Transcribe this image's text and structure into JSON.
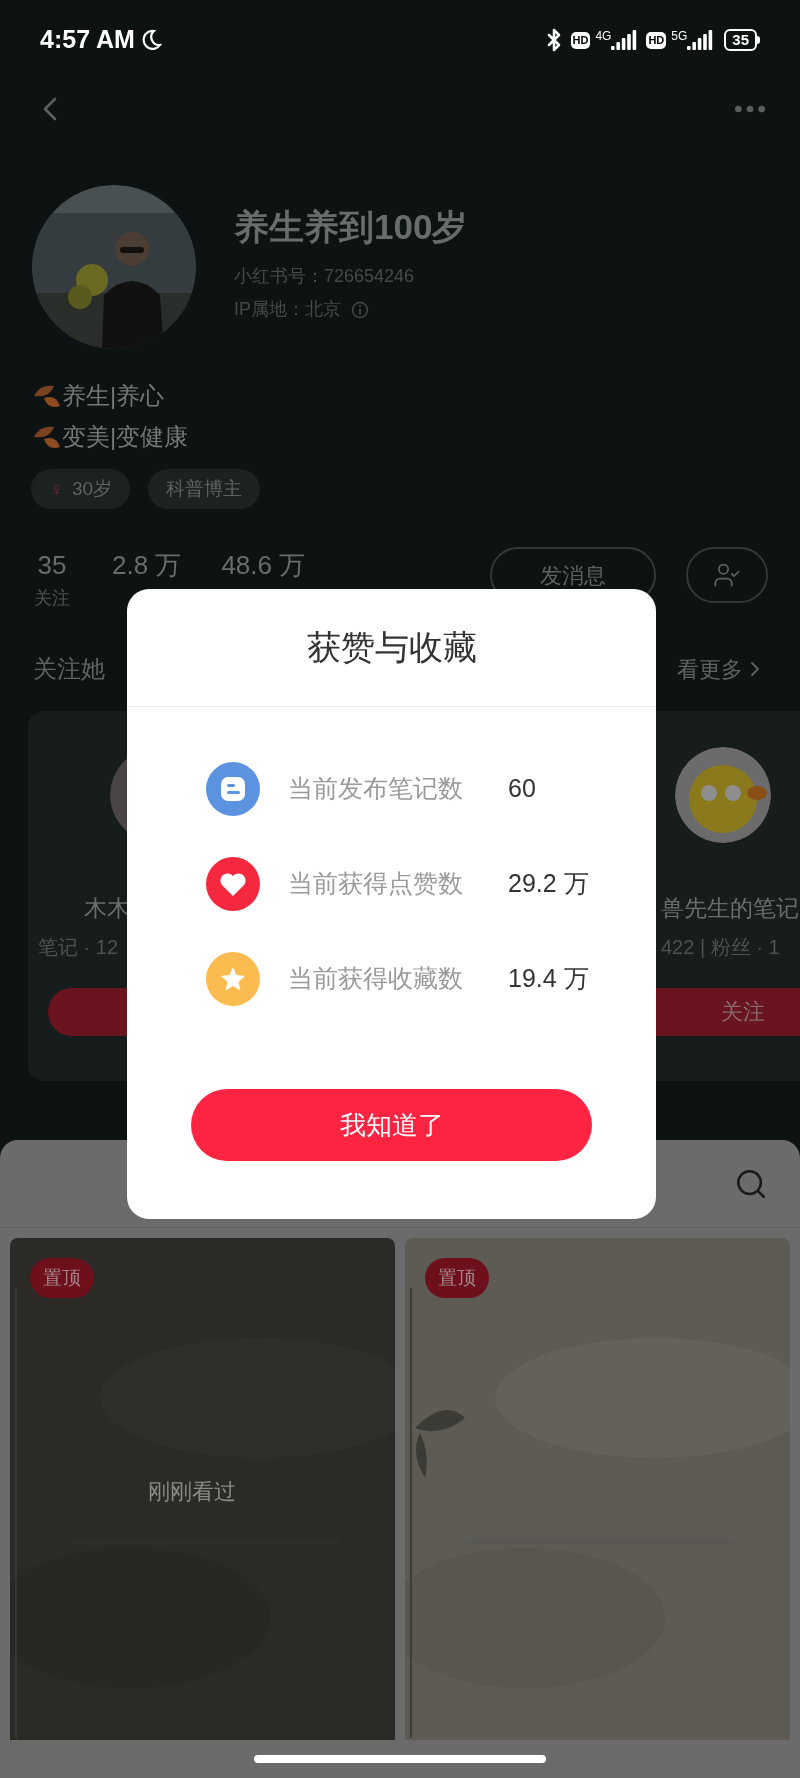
{
  "status_bar": {
    "time": "4:57 AM",
    "hd_1": "HD",
    "network_1": "4G",
    "hd_2": "HD",
    "network_2": "5G",
    "battery": "35"
  },
  "profile": {
    "name": "养生养到100岁",
    "id_line": "小红书号：726654246",
    "ip_line": "IP属地：北京",
    "bio": [
      "养生|养心",
      "变美|变健康"
    ],
    "tags": [
      {
        "kind": "gender",
        "icon": "♀",
        "text": "30岁"
      },
      {
        "kind": "plain",
        "text": "科普博主"
      }
    ]
  },
  "stats": [
    {
      "value": "35",
      "label": "关注"
    },
    {
      "value": "2.8 万"
    },
    {
      "value": "48.6 万"
    }
  ],
  "message_button": "发消息",
  "following_section": {
    "title": "关注她",
    "more": "看更多"
  },
  "recommend_cards": [
    {
      "name": "木木",
      "meta": "笔记 · 12"
    },
    {
      "name": "兽先生的笔记",
      "meta": "422 | 粉丝 · 1",
      "button": "关注"
    }
  ],
  "dialog": {
    "title": "获赞与收藏",
    "rows": [
      {
        "kind": "notes",
        "label": "当前发布笔记数",
        "value": "60"
      },
      {
        "kind": "likes",
        "label": "当前获得点赞数",
        "value": "29.2 万"
      },
      {
        "kind": "collects",
        "label": "当前获得收藏数",
        "value": "19.4 万"
      }
    ],
    "button": "我知道了"
  },
  "notes": [
    {
      "badge": "置顶",
      "overlay": "刚刚看过"
    },
    {
      "badge": "置顶"
    }
  ]
}
